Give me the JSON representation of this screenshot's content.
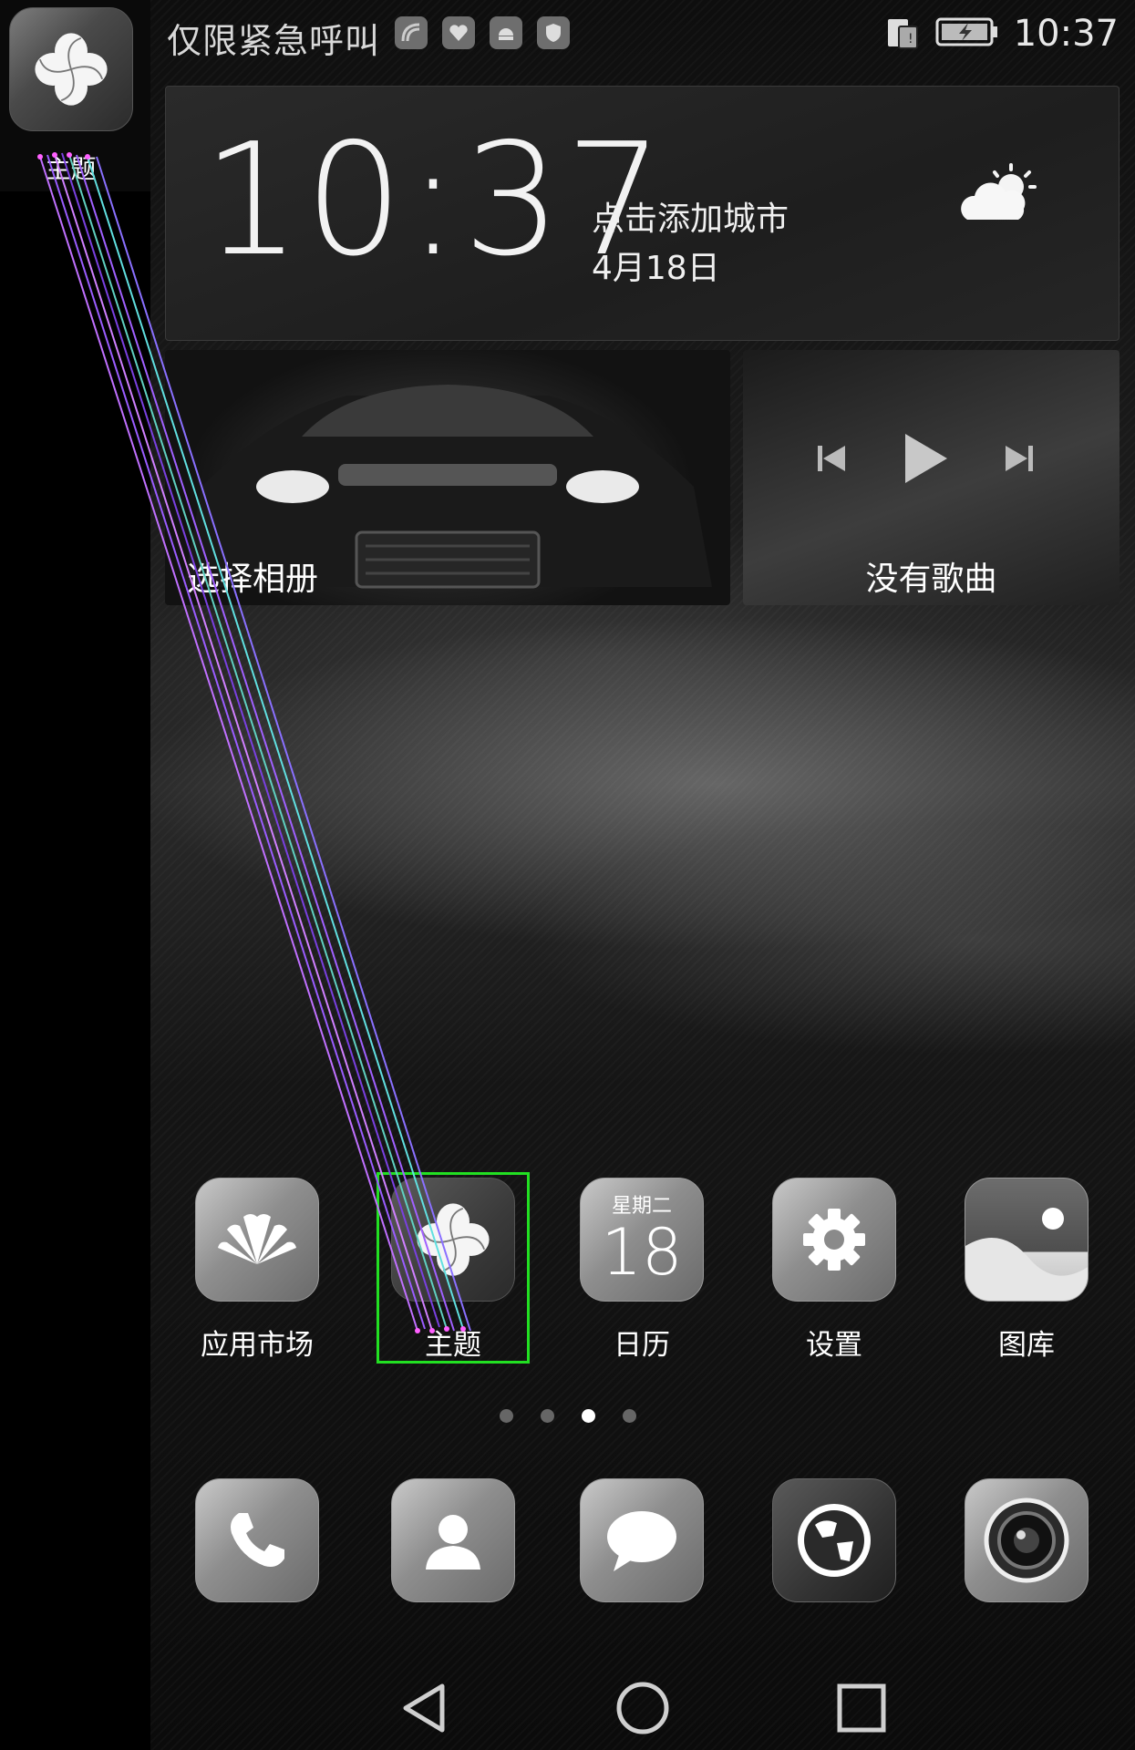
{
  "status_bar": {
    "carrier_text": "仅限紧急呼叫",
    "time": "10:37"
  },
  "drag_item": {
    "label": "主题",
    "icon": "pinwheel-icon"
  },
  "weather_widget": {
    "time": "10:37",
    "city_hint": "点击添加城市",
    "date": "4月18日",
    "weather_icon": "partly-sunny-icon"
  },
  "gallery_widget": {
    "label": "选择相册"
  },
  "music_widget": {
    "label": "没有歌曲"
  },
  "apps": [
    {
      "label": "应用市场",
      "icon": "huawei-flower-icon"
    },
    {
      "label": "主题",
      "icon": "pinwheel-icon"
    },
    {
      "label": "日历",
      "icon": "calendar-icon",
      "weekday": "星期二",
      "day": "18"
    },
    {
      "label": "设置",
      "icon": "gear-icon"
    },
    {
      "label": "图库",
      "icon": "gallery-icon"
    }
  ],
  "dock": [
    {
      "icon": "phone-icon"
    },
    {
      "icon": "contacts-icon"
    },
    {
      "icon": "messages-icon"
    },
    {
      "icon": "browser-globe-icon"
    },
    {
      "icon": "camera-icon"
    }
  ],
  "page_indicator": {
    "total": 4,
    "current": 3
  },
  "colors": {
    "selection": "#22e022"
  }
}
